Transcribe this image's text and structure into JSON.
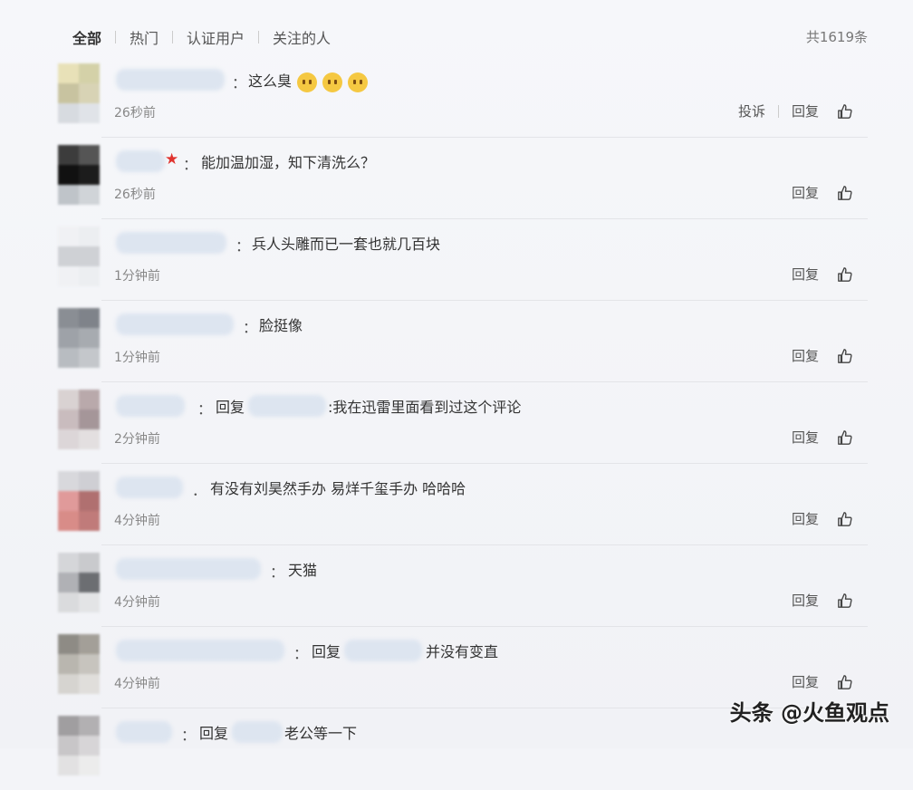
{
  "tabs": [
    "全部",
    "热门",
    "认证用户",
    "关注的人"
  ],
  "total": "共1619条",
  "actions": {
    "report": "投诉",
    "reply": "回复"
  },
  "comments": [
    {
      "text": "这么臭",
      "time": "26秒前",
      "report": true,
      "emoji_count": 3,
      "avatar": [
        "#e8e1b8",
        "#d4d1a8",
        "#c8c3a0",
        "#d8d3b5",
        "#d7dbe0",
        "#e0e3e8"
      ]
    },
    {
      "text": "能加温加湿，知下清洗么？",
      "time": "26秒前",
      "report": false,
      "avatar": [
        "#3c3c3c",
        "#555555",
        "#111111",
        "#1c1c1c",
        "#bfc4c9",
        "#d0d4d8"
      ]
    },
    {
      "text": "兵人头雕而已一套也就几百块",
      "time": "1分钟前",
      "report": false,
      "avatar": [
        "#f0f1f4",
        "#eceef1",
        "#cfd1d5",
        "#cfd1d5",
        "#f0f1f4",
        "#eceef1"
      ]
    },
    {
      "text": "脸挺像",
      "time": "1分钟前",
      "report": false,
      "avatar": [
        "#8a8e94",
        "#7f838a",
        "#9ea2a8",
        "#a7abb0",
        "#b8bcc1",
        "#c4c7cb"
      ]
    },
    {
      "reply_prefix": "回复",
      "text": ":我在迅雷里面看到过这个评论",
      "time": "2分钟前",
      "report": false,
      "avatar": [
        "#d9d2d2",
        "#b9a9ab",
        "#c9bcbe",
        "#a59699",
        "#dcd6d8",
        "#e3dfe0"
      ]
    },
    {
      "text": "有没有刘昊然手办 易烊千玺手办 哈哈哈",
      "time": "4分钟前",
      "report": false,
      "avatar": [
        "#d8d8dc",
        "#cfcfd4",
        "#e09a9a",
        "#b07070",
        "#d88c88",
        "#c07b7a"
      ]
    },
    {
      "text": "天猫",
      "time": "4分钟前",
      "report": false,
      "avatar": [
        "#d5d6d9",
        "#c9cacd",
        "#b0b1b5",
        "#6c6e72",
        "#dadbdd",
        "#e3e4e6"
      ]
    },
    {
      "reply_prefix": "回复",
      "text": "并没有变直",
      "time": "4分钟前",
      "report": false,
      "avatar": [
        "#8e8b85",
        "#a39f98",
        "#b9b6af",
        "#c7c4be",
        "#d6d4d0",
        "#e0dedb"
      ]
    },
    {
      "reply_prefix": "回复",
      "text": "老公等一下",
      "time": "",
      "report": false,
      "avatar": [
        "#a09ea0",
        "#b2b0b2",
        "#c8c6c8",
        "#d7d5d7",
        "#e2e1e2",
        "#ececec"
      ]
    }
  ],
  "watermark": "头条 @火鱼观点"
}
